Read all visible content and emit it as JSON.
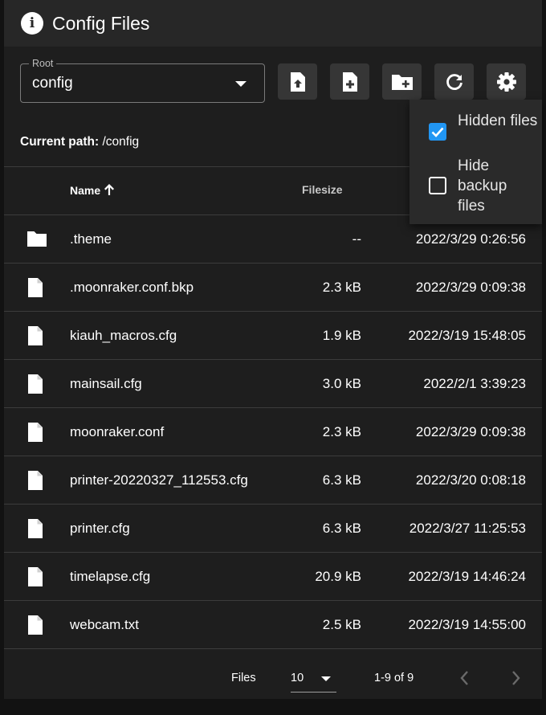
{
  "header": {
    "title": "Config Files",
    "icon": "info-icon"
  },
  "root_select": {
    "label": "Root",
    "value": "config"
  },
  "toolbar": {
    "buttons": [
      {
        "name": "upload-file-button",
        "icon": "file-upload-icon"
      },
      {
        "name": "create-file-button",
        "icon": "file-plus-icon"
      },
      {
        "name": "create-folder-button",
        "icon": "folder-plus-icon"
      },
      {
        "name": "refresh-button",
        "icon": "refresh-icon"
      },
      {
        "name": "settings-button",
        "icon": "gear-icon"
      }
    ]
  },
  "current_path": {
    "label": "Current path:",
    "value": " /config"
  },
  "table": {
    "columns": {
      "name": "Name",
      "filesize": "Filesize"
    },
    "rows": [
      {
        "type": "folder",
        "name": ".theme",
        "size": "--",
        "date": "2022/3/29 0:26:56"
      },
      {
        "type": "file",
        "name": ".moonraker.conf.bkp",
        "size": "2.3 kB",
        "date": "2022/3/29 0:09:38"
      },
      {
        "type": "file",
        "name": "kiauh_macros.cfg",
        "size": "1.9 kB",
        "date": "2022/3/19 15:48:05"
      },
      {
        "type": "file",
        "name": "mainsail.cfg",
        "size": "3.0 kB",
        "date": "2022/2/1 3:39:23"
      },
      {
        "type": "file",
        "name": "moonraker.conf",
        "size": "2.3 kB",
        "date": "2022/3/29 0:09:38"
      },
      {
        "type": "file",
        "name": "printer-20220327_112553.cfg",
        "size": "6.3 kB",
        "date": "2022/3/20 0:08:18"
      },
      {
        "type": "file",
        "name": "printer.cfg",
        "size": "6.3 kB",
        "date": "2022/3/27 11:25:53"
      },
      {
        "type": "file",
        "name": "timelapse.cfg",
        "size": "20.9 kB",
        "date": "2022/3/19 14:46:24"
      },
      {
        "type": "file",
        "name": "webcam.txt",
        "size": "2.5 kB",
        "date": "2022/3/19 14:55:00"
      }
    ]
  },
  "footer": {
    "per_page_label": "Files",
    "per_page_value": "10",
    "range": "1-9 of 9"
  },
  "settings_menu": {
    "options": [
      {
        "label": "Hidden files",
        "checked": true
      },
      {
        "label": "Hide backup files",
        "checked": false
      }
    ]
  },
  "colors": {
    "accent": "#2196f3",
    "card": "#1e1e1e",
    "header": "#272727"
  }
}
